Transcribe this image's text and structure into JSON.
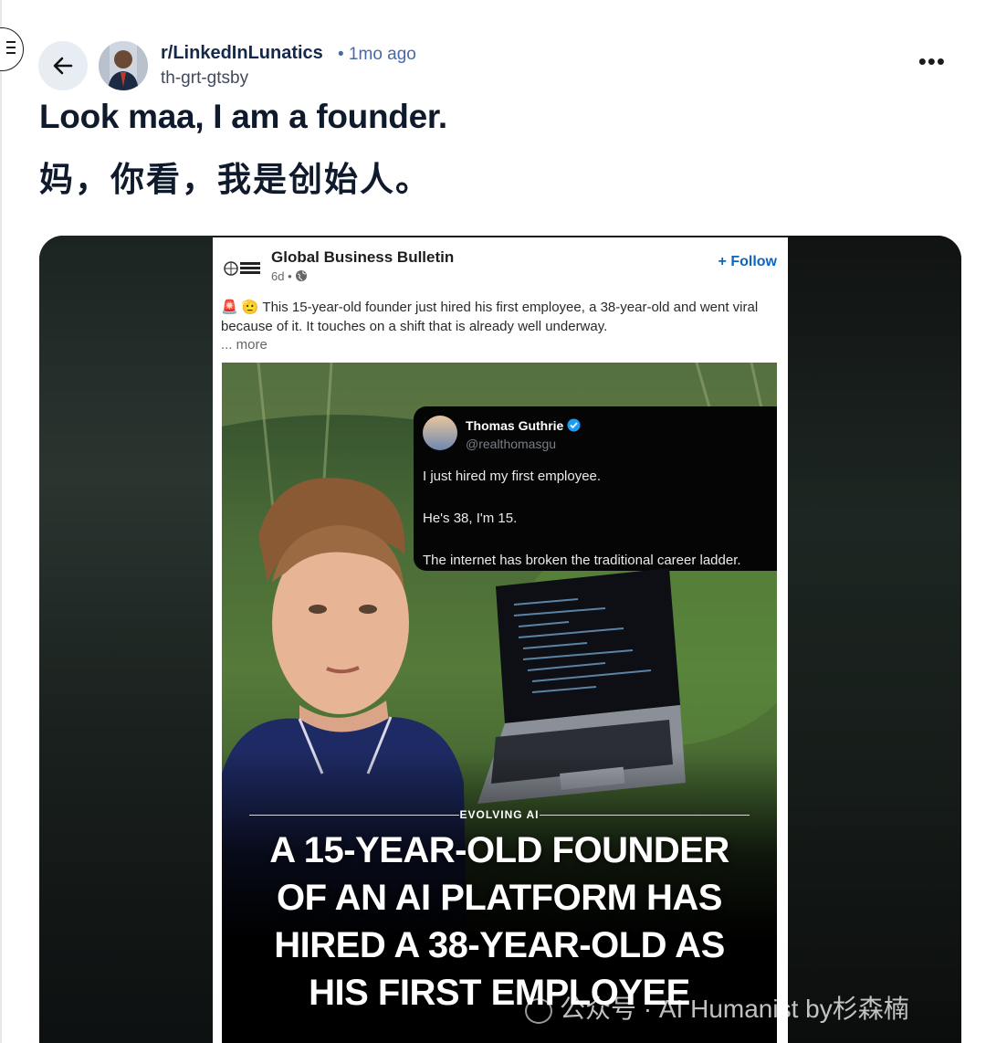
{
  "post": {
    "subreddit": "r/LinkedInLunatics",
    "age": "• 1mo ago",
    "username": "th-grt-gtsby",
    "title_en": "Look maa, I am a founder.",
    "title_zh": "妈，你看，我是创始人。",
    "more_label": "•••"
  },
  "linkedin": {
    "company": "Global Business Bulletin",
    "time": "6d •",
    "follow": "+ Follow",
    "text": "🚨 🫡 This 15-year-old founder just hired his first employee, a 38-year-old and went viral because of it. It touches on a shift that is already well underway.",
    "more": "... more"
  },
  "tweet": {
    "name": "Thomas Guthrie",
    "handle": "@realthomasgu",
    "lines": [
      "I just hired my first employee.",
      "He's 38, I'm 15.",
      "The internet has broken the traditional career ladder."
    ]
  },
  "image": {
    "brand": "EVOLVING AI",
    "headline": [
      "A 15-YEAR-OLD FOUNDER",
      "OF AN AI PLATFORM HAS",
      "HIRED A 38-YEAR-OLD AS",
      "HIS FIRST EMPLOYEE"
    ]
  },
  "watermark": "公众号 · AI Humanist by杉森楠",
  "colors": {
    "link": "#0a66c2",
    "verified": "#1d9bf0"
  }
}
